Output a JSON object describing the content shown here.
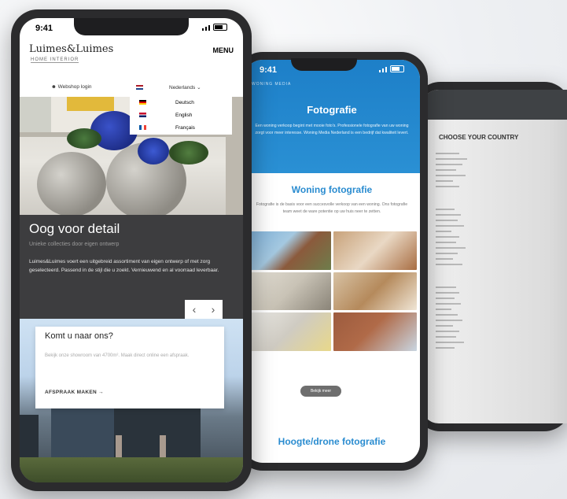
{
  "phone1": {
    "status": {
      "time": "9:41"
    },
    "header": {
      "logo": "Luimes&Luimes",
      "logo_sub": "HOME INTERIOR",
      "menu": "MENU"
    },
    "toolbar": {
      "login": "Webshop login",
      "language": "Nederlands"
    },
    "language_options": [
      "Deutsch",
      "English",
      "Français"
    ],
    "hero_section": {
      "title": "Oog voor detail",
      "subtitle": "Unieke collecties door eigen ontwerp",
      "body": "Luimes&Luimes voert een uitgebreid assortiment van eigen ontwerp of met zorg geselecteerd. Passend in de stijl die u zoekt. Vernieuwend en al voorraad leverbaar."
    },
    "carousel": {
      "prev": "‹",
      "next": "›"
    },
    "visit_card": {
      "title": "Komt u naar ons?",
      "text": "Bekijk onze showroom van 4700m². Maak direct online een afspraak.",
      "cta": "AFSPRAAK MAKEN →"
    }
  },
  "phone2": {
    "status": {
      "time": "9:41"
    },
    "nav_label": "WONING MEDIA",
    "hero": {
      "title": "Fotografie",
      "text": "Een woning verkoop begint met mooie foto's. Professionele fotografie van uw woning zorgt voor meer interesse. Woning Media Nederland is een bedrijf dat kwaliteit levert."
    },
    "section1": {
      "title": "Woning fotografie",
      "text": "Fotografie is de basis voor een succesvolle verkoop van een woning. Ons fotografie team weet de ware potentie op uw huis neer te zetten."
    },
    "button": "Bekijk meer",
    "section2": {
      "title": "Hoogte/drone fotografie"
    },
    "colors": {
      "accent": "#2a8cd0"
    }
  },
  "phone3": {
    "title": "CHOOSE YOUR COUNTRY"
  }
}
